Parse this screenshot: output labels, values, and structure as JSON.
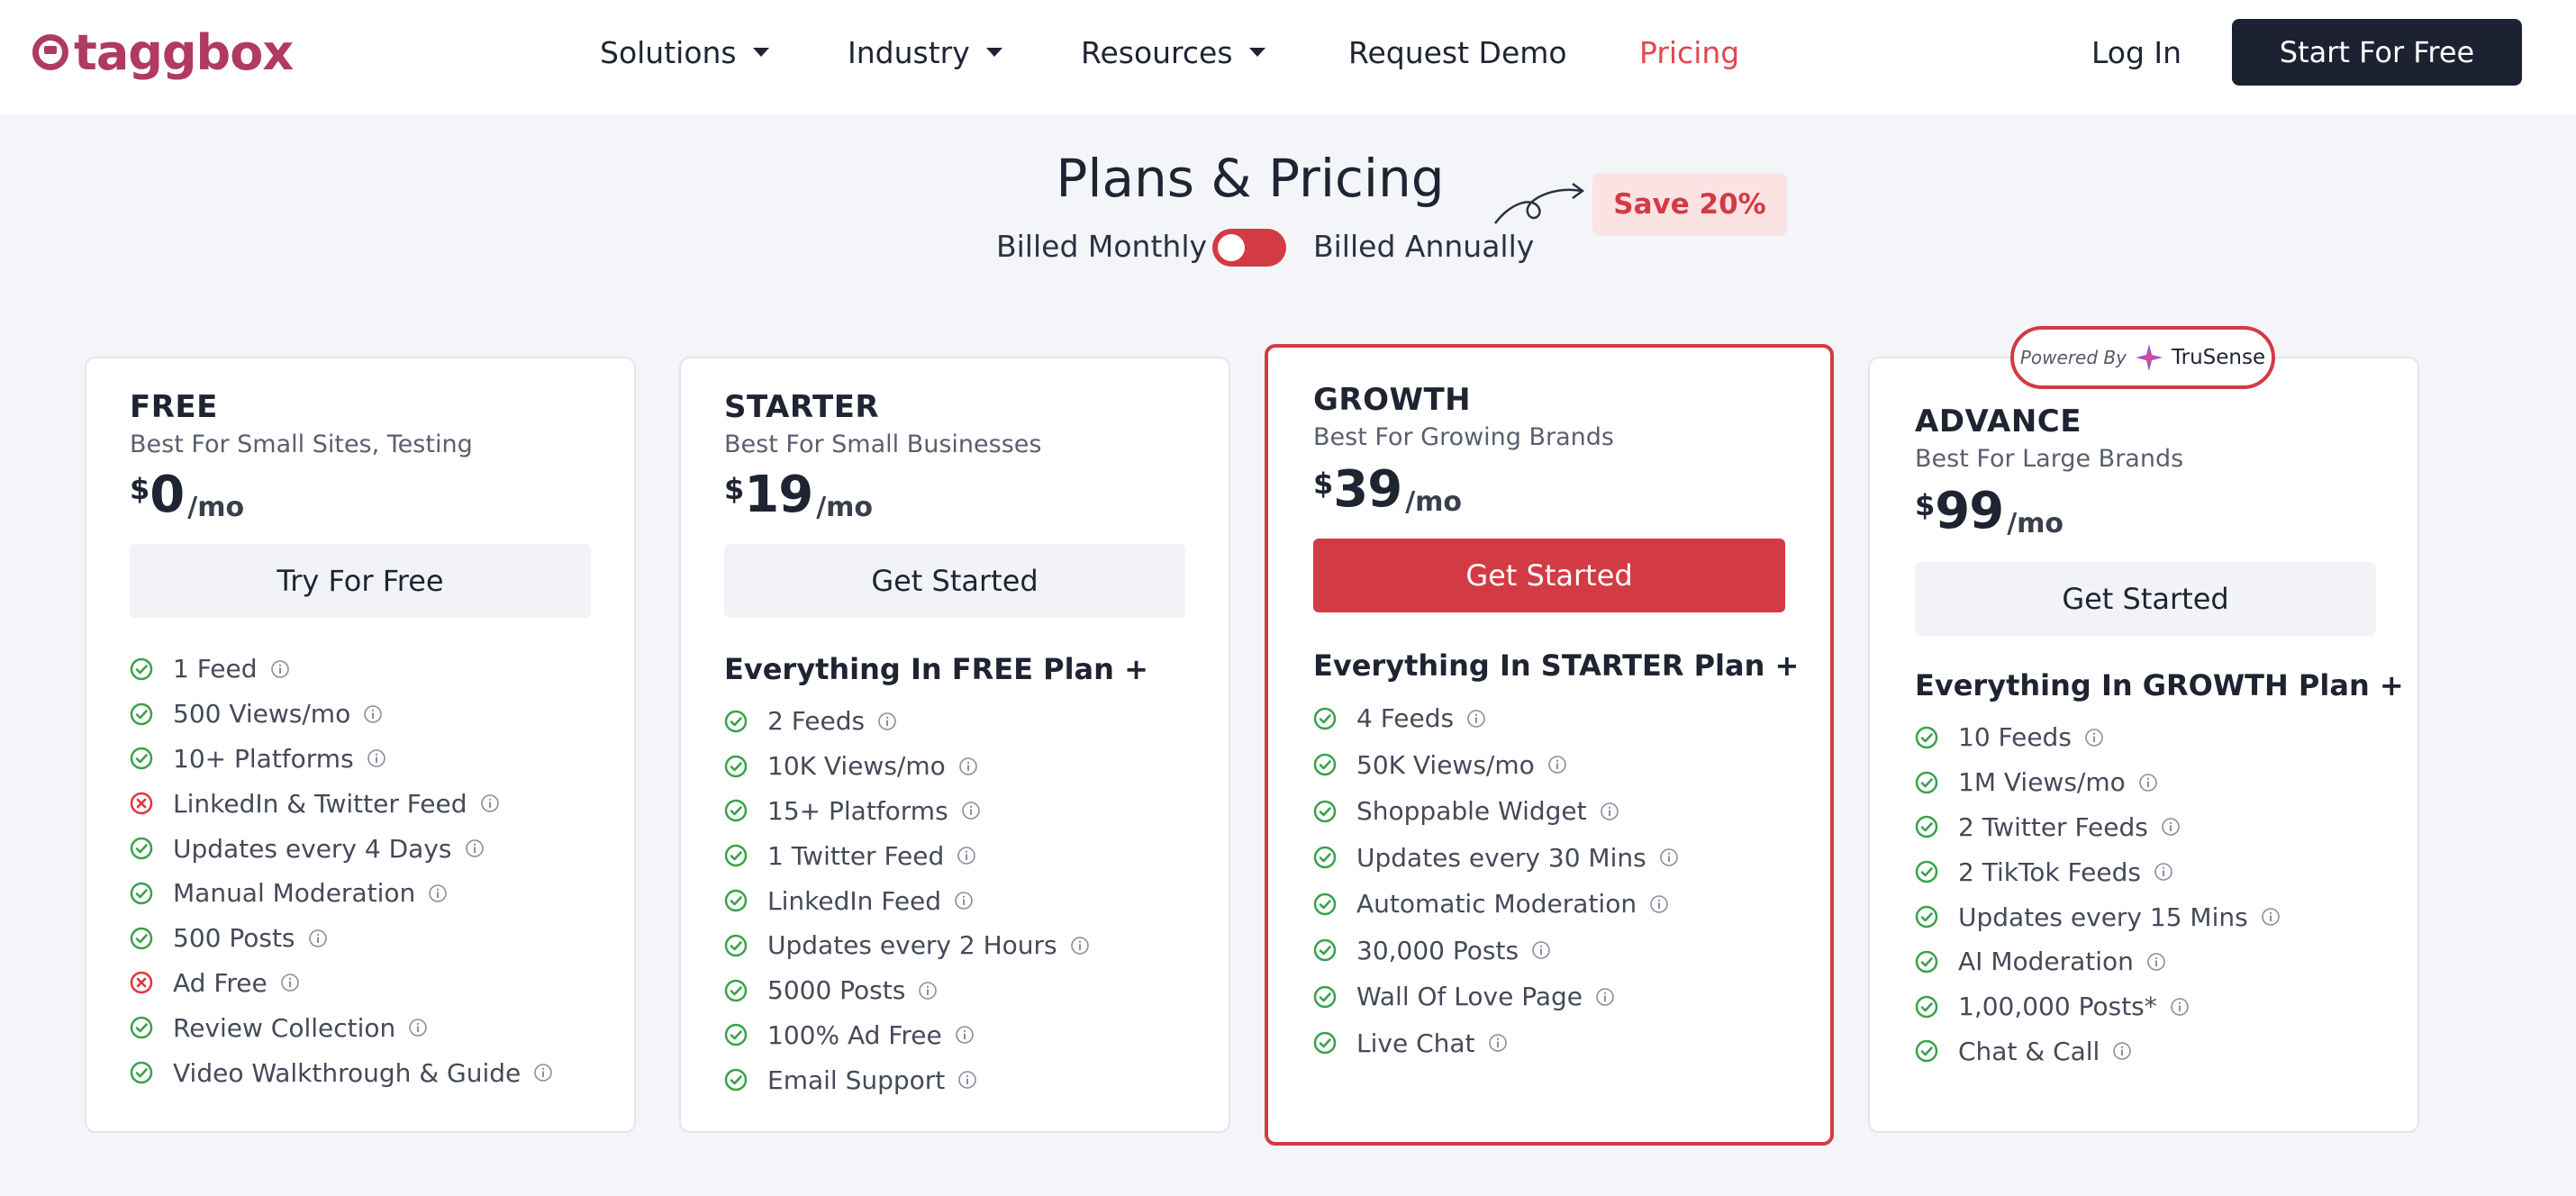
{
  "nav": {
    "logo_text": "taggbox",
    "items": [
      {
        "label": "Solutions",
        "dropdown": true
      },
      {
        "label": "Industry",
        "dropdown": true
      },
      {
        "label": "Resources",
        "dropdown": true
      },
      {
        "label": "Request Demo",
        "dropdown": false
      },
      {
        "label": "Pricing",
        "dropdown": false,
        "active": true
      }
    ],
    "login": "Log In",
    "cta": "Start For Free"
  },
  "header": {
    "title": "Plans & Pricing",
    "billed_monthly": "Billed Monthly",
    "billed_annually": "Billed Annually",
    "save_badge": "Save 20%"
  },
  "powered_by": {
    "prefix": "Powered By",
    "brand": "TruSense"
  },
  "colors": {
    "accent": "#d33b44",
    "check": "#3aa14a",
    "cross": "#e0343d",
    "brand": "#b03a63"
  },
  "plans": [
    {
      "name": "FREE",
      "subtitle": "Best For Small Sites, Testing",
      "currency": "$",
      "price": "0",
      "period": "/mo",
      "cta": "Try For Free",
      "everything": "",
      "features": [
        {
          "text": "1 Feed",
          "included": true
        },
        {
          "text": "500 Views/mo",
          "included": true
        },
        {
          "text": "10+ Platforms",
          "included": true
        },
        {
          "text": "LinkedIn & Twitter Feed",
          "included": false
        },
        {
          "text": "Updates every 4 Days",
          "included": true
        },
        {
          "text": "Manual Moderation",
          "included": true
        },
        {
          "text": "500 Posts",
          "included": true
        },
        {
          "text": "Ad Free",
          "included": false
        },
        {
          "text": "Review Collection",
          "included": true
        },
        {
          "text": "Video Walkthrough & Guide",
          "included": true
        }
      ]
    },
    {
      "name": "STARTER",
      "subtitle": "Best For Small Businesses",
      "currency": "$",
      "price": "19",
      "period": "/mo",
      "cta": "Get Started",
      "everything": "Everything In FREE Plan +",
      "features": [
        {
          "text": "2 Feeds",
          "included": true
        },
        {
          "text": "10K Views/mo",
          "included": true
        },
        {
          "text": "15+ Platforms",
          "included": true
        },
        {
          "text": "1 Twitter Feed",
          "included": true
        },
        {
          "text": "LinkedIn Feed",
          "included": true
        },
        {
          "text": "Updates every 2 Hours",
          "included": true
        },
        {
          "text": "5000 Posts",
          "included": true
        },
        {
          "text": "100% Ad Free",
          "included": true
        },
        {
          "text": "Email Support",
          "included": true
        }
      ]
    },
    {
      "name": "GROWTH",
      "subtitle": "Best For Growing Brands",
      "currency": "$",
      "price": "39",
      "period": "/mo",
      "cta": "Get Started",
      "everything": "Everything In STARTER Plan +",
      "features": [
        {
          "text": "4 Feeds",
          "included": true
        },
        {
          "text": "50K Views/mo",
          "included": true
        },
        {
          "text": "Shoppable Widget",
          "included": true
        },
        {
          "text": "Updates every 30 Mins",
          "included": true
        },
        {
          "text": "Automatic Moderation",
          "included": true
        },
        {
          "text": "30,000 Posts",
          "included": true
        },
        {
          "text": "Wall Of Love Page",
          "included": true
        },
        {
          "text": "Live Chat",
          "included": true
        }
      ]
    },
    {
      "name": "ADVANCE",
      "subtitle": "Best For Large Brands",
      "currency": "$",
      "price": "99",
      "period": "/mo",
      "cta": "Get Started",
      "everything": "Everything In GROWTH Plan +",
      "features": [
        {
          "text": "10 Feeds",
          "included": true
        },
        {
          "text": "1M Views/mo",
          "included": true
        },
        {
          "text": "2 Twitter Feeds",
          "included": true
        },
        {
          "text": "2 TikTok Feeds",
          "included": true
        },
        {
          "text": "Updates every 15 Mins",
          "included": true
        },
        {
          "text": "AI Moderation",
          "included": true
        },
        {
          "text": "1,00,000 Posts*",
          "included": true
        },
        {
          "text": "Chat & Call",
          "included": true
        }
      ]
    }
  ]
}
